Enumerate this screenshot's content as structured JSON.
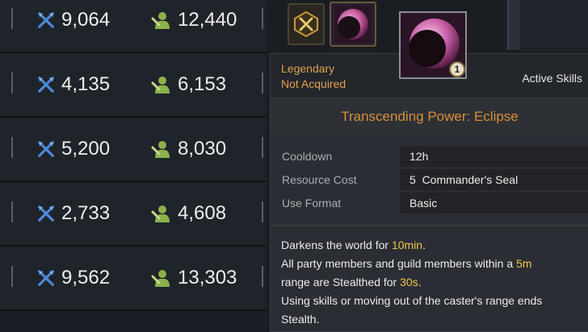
{
  "rows": [
    {
      "power": "9,064",
      "members": "12,440"
    },
    {
      "power": "4,135",
      "members": "6,153"
    },
    {
      "power": "5,200",
      "members": "8,030"
    },
    {
      "power": "2,733",
      "members": "4,608"
    },
    {
      "power": "9,562",
      "members": "13,303"
    }
  ],
  "tooltip": {
    "grade": "Legendary",
    "status": "Not Acquired",
    "category": "Active Skills",
    "title": "Transcending Power: Eclipse",
    "cooldown_label": "Cooldown",
    "cooldown_value": "12h",
    "cost_label": "Resource Cost",
    "cost_value": "5  Commander's Seal",
    "format_label": "Use Format",
    "format_value": "Basic",
    "desc": {
      "l1a": "Darkens the world for ",
      "l1b": "10min",
      "l1c": ".",
      "l2a": "All party members and guild members within a ",
      "l2b": "5m",
      "l3a": "range are Stealthed for ",
      "l3b": "30s",
      "l3c": ".",
      "l4": "Using skills or moving out of the caster's range ends",
      "l5": "Stealth."
    },
    "badge": "1"
  },
  "icons": {
    "power": "crossed-swords-icon",
    "members": "member-icon",
    "slot_a": "crossed-swords-emblem-icon",
    "slot_b": "eclipse-icon"
  },
  "colors": {
    "accent_orange": "#d98f3b",
    "highlight_yellow": "#f0c64a",
    "power_icon": "#4a8ad8",
    "member_icon": "#8bb24a"
  }
}
